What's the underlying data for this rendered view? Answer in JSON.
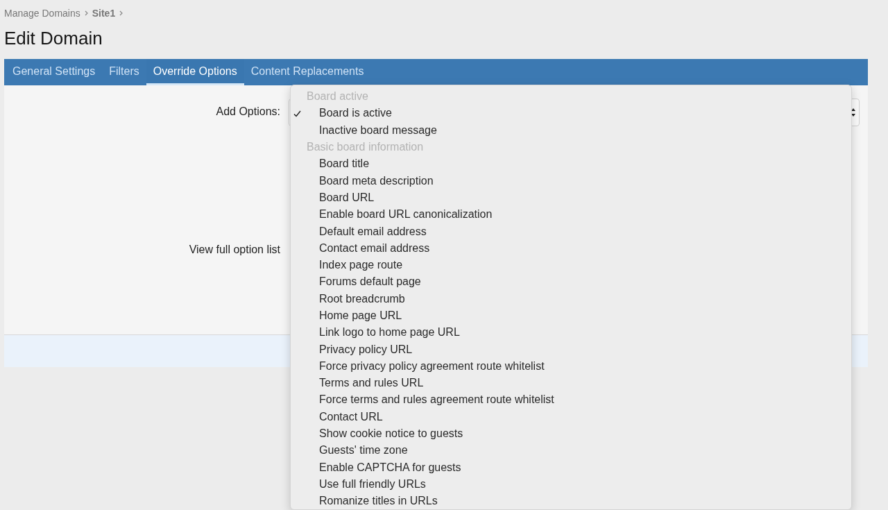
{
  "breadcrumb": [
    {
      "label": "Manage Domains",
      "current": false
    },
    {
      "label": "Site1",
      "current": true
    }
  ],
  "title": "Edit Domain",
  "tabs": [
    {
      "label": "General Settings",
      "selected": false
    },
    {
      "label": "Filters",
      "selected": false
    },
    {
      "label": "Override Options",
      "selected": true
    },
    {
      "label": "Content Replacements",
      "selected": false
    }
  ],
  "form": {
    "add_options_label": "Add Options:",
    "full_list_label": "View full option list"
  },
  "dropdown": {
    "groups": [
      {
        "label": "Board active",
        "options": [
          {
            "label": "Board is active",
            "checked": true
          },
          {
            "label": "Inactive board message",
            "checked": false
          }
        ]
      },
      {
        "label": "Basic board information",
        "options": [
          {
            "label": "Board title",
            "checked": false
          },
          {
            "label": "Board meta description",
            "checked": false
          },
          {
            "label": "Board URL",
            "checked": false
          },
          {
            "label": "Enable board URL canonicalization",
            "checked": false
          },
          {
            "label": "Default email address",
            "checked": false
          },
          {
            "label": "Contact email address",
            "checked": false
          },
          {
            "label": "Index page route",
            "checked": false
          },
          {
            "label": "Forums default page",
            "checked": false
          },
          {
            "label": "Root breadcrumb",
            "checked": false
          },
          {
            "label": "Home page URL",
            "checked": false
          },
          {
            "label": "Link logo to home page URL",
            "checked": false
          },
          {
            "label": "Privacy policy URL",
            "checked": false
          },
          {
            "label": "Force privacy policy agreement route whitelist",
            "checked": false
          },
          {
            "label": "Terms and rules URL",
            "checked": false
          },
          {
            "label": "Force terms and rules agreement route whitelist",
            "checked": false
          },
          {
            "label": "Contact URL",
            "checked": false
          },
          {
            "label": "Show cookie notice to guests",
            "checked": false
          },
          {
            "label": "Guests' time zone",
            "checked": false
          },
          {
            "label": "Enable CAPTCHA for guests",
            "checked": false
          },
          {
            "label": "Use full friendly URLs",
            "checked": false
          },
          {
            "label": "Romanize titles in URLs",
            "checked": false
          }
        ]
      }
    ]
  }
}
